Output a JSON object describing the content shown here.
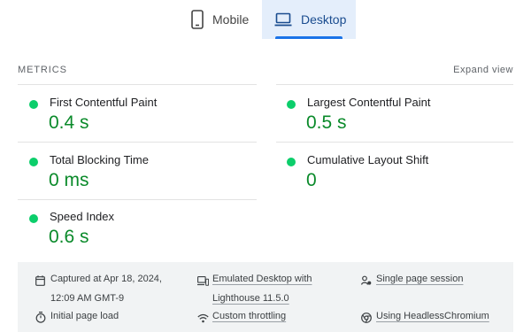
{
  "tabs": {
    "mobile_label": "Mobile",
    "desktop_label": "Desktop",
    "active": "Desktop"
  },
  "metrics": {
    "title": "METRICS",
    "expand_label": "Expand view",
    "status_color": "#0cce6b",
    "value_color": "#0a8a2a",
    "items": [
      {
        "label": "First Contentful Paint",
        "value": "0.4 s",
        "status": "good"
      },
      {
        "label": "Largest Contentful Paint",
        "value": "0.5 s",
        "status": "good"
      },
      {
        "label": "Total Blocking Time",
        "value": "0 ms",
        "status": "good"
      },
      {
        "label": "Cumulative Layout Shift",
        "value": "0",
        "status": "good"
      },
      {
        "label": "Speed Index",
        "value": "0.6 s",
        "status": "good"
      }
    ]
  },
  "runtime_settings": {
    "captured_line1": "Captured at Apr 18, 2024,",
    "captured_line2": "12:09 AM GMT-9",
    "emulated_line1": "Emulated Desktop with",
    "emulated_line2": "Lighthouse 11.5.0",
    "session": "Single page session",
    "initial_load": "Initial page load",
    "throttling": "Custom throttling",
    "browser": "Using HeadlessChromium"
  },
  "icons": {
    "mobile": "smartphone-icon",
    "desktop": "laptop-icon",
    "calendar": "calendar-icon",
    "emulated": "devices-icon",
    "session": "person-icon",
    "timer": "timer-icon",
    "throttling": "wifi-icon",
    "browser": "chrome-icon"
  }
}
